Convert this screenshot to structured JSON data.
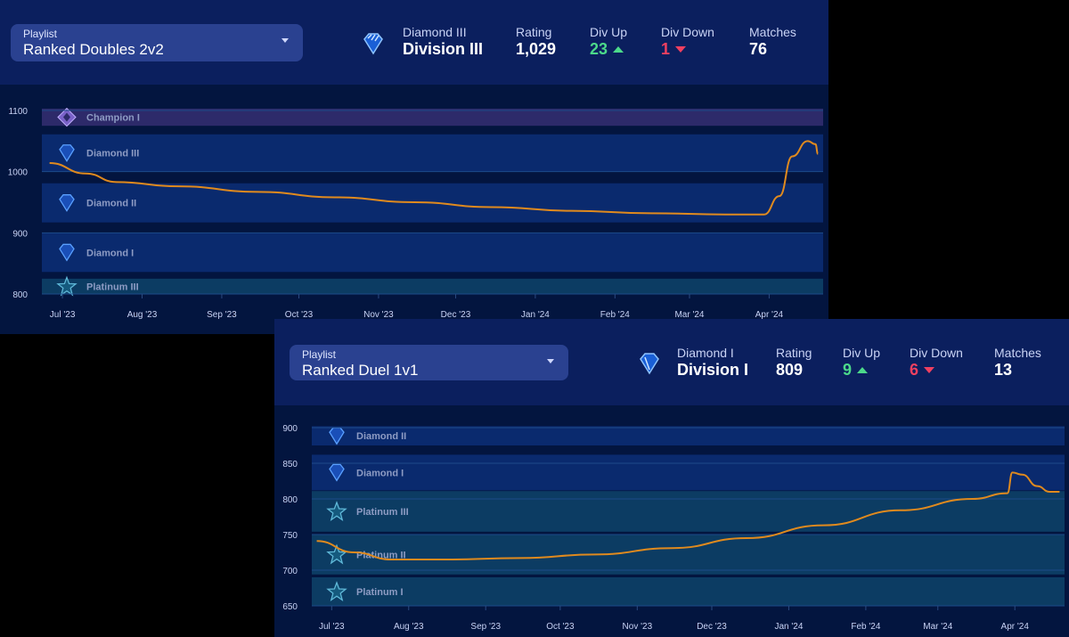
{
  "panels": [
    {
      "playlist_label": "Playlist",
      "playlist_value": "Ranked Doubles 2v2",
      "rank_icon": "diamond-rank-icon",
      "rank_name": "Diamond III",
      "division": "Division III",
      "rating_label": "Rating",
      "rating": "1,029",
      "div_up_label": "Div Up",
      "div_up": "23",
      "div_down_label": "Div Down",
      "div_down": "1",
      "matches_label": "Matches",
      "matches": "76"
    },
    {
      "playlist_label": "Playlist",
      "playlist_value": "Ranked Duel 1v1",
      "rank_icon": "diamond-rank-icon",
      "rank_name": "Diamond I",
      "division": "Division I",
      "rating_label": "Rating",
      "rating": "809",
      "div_up_label": "Div Up",
      "div_up": "9",
      "div_down_label": "Div Down",
      "div_down": "6",
      "matches_label": "Matches",
      "matches": "13"
    }
  ],
  "colors": {
    "line": "#e08a1e",
    "up": "#4cd98a",
    "down": "#f04060",
    "diamond_band": "#0a2a6e",
    "platinum_band": "#0c3c63",
    "champion_band": "#2d2a6a"
  },
  "chart_data": [
    {
      "type": "line",
      "ylim": [
        800,
        1100
      ],
      "yticks": [
        "800",
        "900",
        "1000",
        "1100"
      ],
      "xlim": [
        "2023-06-23",
        "2024-04-22"
      ],
      "xticks": [
        [
          "2023-07-01",
          "Jul '23"
        ],
        [
          "2023-08-01",
          "Aug '23"
        ],
        [
          "2023-09-01",
          "Sep '23"
        ],
        [
          "2023-10-01",
          "Oct '23"
        ],
        [
          "2023-11-01",
          "Nov '23"
        ],
        [
          "2023-12-01",
          "Dec '23"
        ],
        [
          "2024-01-01",
          "Jan '24"
        ],
        [
          "2024-02-01",
          "Feb '24"
        ],
        [
          "2024-03-01",
          "Mar '24"
        ],
        [
          "2024-04-01",
          "Apr '24"
        ]
      ],
      "bands": [
        {
          "label": "Champion I",
          "tier": "champion",
          "range": [
            1075,
            1103
          ]
        },
        {
          "label": "Diamond III",
          "tier": "diamond",
          "range": [
            1000,
            1061
          ]
        },
        {
          "label": "Diamond II",
          "tier": "diamond",
          "range": [
            917,
            981
          ]
        },
        {
          "label": "Diamond I",
          "tier": "diamond",
          "range": [
            836,
            900
          ]
        },
        {
          "label": "Platinum III",
          "tier": "platinum",
          "range": [
            800,
            825
          ]
        }
      ],
      "points": [
        [
          "2023-06-26",
          1014
        ],
        [
          "2023-07-10",
          997
        ],
        [
          "2023-07-22",
          983
        ],
        [
          "2023-08-15",
          976
        ],
        [
          "2023-09-15",
          967
        ],
        [
          "2023-10-15",
          958
        ],
        [
          "2023-11-15",
          950
        ],
        [
          "2023-12-15",
          942
        ],
        [
          "2024-01-15",
          936
        ],
        [
          "2024-02-15",
          932
        ],
        [
          "2024-03-15",
          930
        ],
        [
          "2024-03-30",
          930
        ],
        [
          "2024-04-05",
          960
        ],
        [
          "2024-04-10",
          1025
        ],
        [
          "2024-04-16",
          1050
        ],
        [
          "2024-04-19",
          1045
        ],
        [
          "2024-04-20",
          1029
        ]
      ]
    },
    {
      "type": "line",
      "ylim": [
        650,
        900
      ],
      "yticks": [
        "650",
        "700",
        "750",
        "800",
        "850",
        "900"
      ],
      "xlim": [
        "2023-06-23",
        "2024-04-21"
      ],
      "xticks": [
        [
          "2023-07-01",
          "Jul '23"
        ],
        [
          "2023-08-01",
          "Aug '23"
        ],
        [
          "2023-09-01",
          "Sep '23"
        ],
        [
          "2023-10-01",
          "Oct '23"
        ],
        [
          "2023-11-01",
          "Nov '23"
        ],
        [
          "2023-12-01",
          "Dec '23"
        ],
        [
          "2024-01-01",
          "Jan '24"
        ],
        [
          "2024-02-01",
          "Feb '24"
        ],
        [
          "2024-03-01",
          "Mar '24"
        ],
        [
          "2024-04-01",
          "Apr '24"
        ]
      ],
      "bands": [
        {
          "label": "Diamond II",
          "tier": "diamond",
          "range": [
            875,
            902
          ]
        },
        {
          "label": "Diamond I",
          "tier": "diamond",
          "range": [
            812,
            862
          ]
        },
        {
          "label": "Platinum III",
          "tier": "platinum",
          "range": [
            754,
            811
          ]
        },
        {
          "label": "Platinum II",
          "tier": "platinum",
          "range": [
            694,
            750
          ]
        },
        {
          "label": "Platinum I",
          "tier": "platinum",
          "range": [
            650,
            690
          ]
        }
      ],
      "points": [
        [
          "2023-06-25",
          741
        ],
        [
          "2023-07-10",
          725
        ],
        [
          "2023-07-25",
          715
        ],
        [
          "2023-08-15",
          715
        ],
        [
          "2023-09-15",
          717
        ],
        [
          "2023-10-15",
          722
        ],
        [
          "2023-11-15",
          731
        ],
        [
          "2023-12-15",
          745
        ],
        [
          "2024-01-15",
          763
        ],
        [
          "2024-02-15",
          784
        ],
        [
          "2024-03-15",
          800
        ],
        [
          "2024-03-29",
          808
        ],
        [
          "2024-03-31",
          837
        ],
        [
          "2024-04-04",
          834
        ],
        [
          "2024-04-10",
          818
        ],
        [
          "2024-04-15",
          810
        ],
        [
          "2024-04-19",
          810
        ]
      ]
    }
  ]
}
